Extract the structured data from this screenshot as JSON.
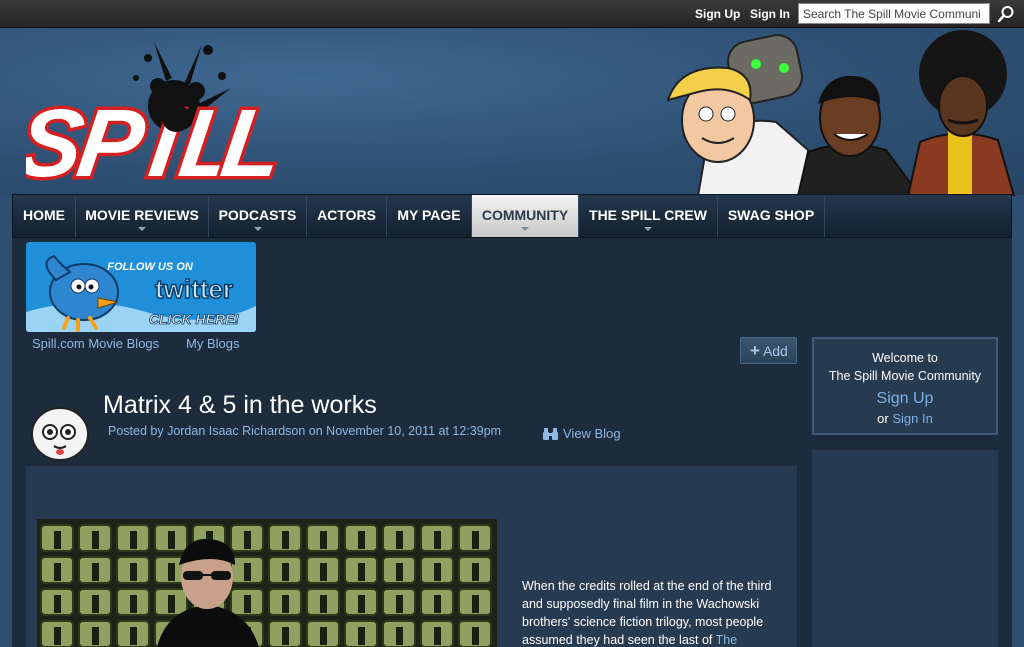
{
  "topbar": {
    "sign_up": "Sign Up",
    "sign_in": "Sign In",
    "search_placeholder": "Search The Spill Movie Communi",
    "search_icon": "search-icon"
  },
  "nav": {
    "items": [
      {
        "label": "HOME",
        "has_menu": false
      },
      {
        "label": "MOVIE REVIEWS",
        "has_menu": true
      },
      {
        "label": "PODCASTS",
        "has_menu": true
      },
      {
        "label": "ACTORS",
        "has_menu": false
      },
      {
        "label": "MY PAGE",
        "has_menu": false
      },
      {
        "label": "COMMUNITY",
        "has_menu": true,
        "active": true
      },
      {
        "label": "THE SPILL CREW",
        "has_menu": true
      },
      {
        "label": "SWAG SHOP",
        "has_menu": false
      }
    ]
  },
  "banner": {
    "line1": "FOLLOW US ON",
    "line2": "twitter",
    "line3": "CLICK HERE!"
  },
  "blog_links": {
    "spill_blogs": "Spill.com Movie Blogs",
    "my_blogs": "My Blogs"
  },
  "add_button": {
    "label": "Add"
  },
  "welcome": {
    "line1": "Welcome to",
    "line2": "The Spill Movie Community",
    "sign_up": "Sign Up",
    "or": "or",
    "sign_in": "Sign In"
  },
  "post": {
    "title": "Matrix 4 & 5 in the works",
    "meta": "Posted by Jordan Isaac Richardson on November 10, 2011 at 12:39pm",
    "view_blog": "View Blog",
    "text_before": "When the credits rolled at the end of the third and supposedly final film in the Wachowski brothers' science fiction trilogy, most people assumed they had seen the last of",
    "text_link": "The"
  },
  "colors": {
    "background": "#2e4f72",
    "link": "#8fb8e2",
    "nav_active": "#e0e0e0",
    "logo_red": "#d42020"
  }
}
